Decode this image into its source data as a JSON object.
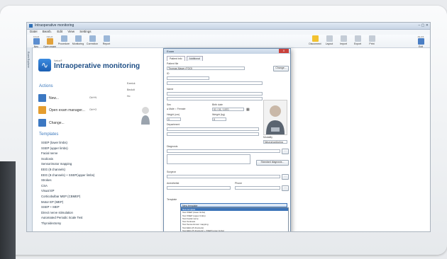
{
  "window": {
    "title": "Intraoperative monitoring"
  },
  "menu": [
    "Datei",
    "Bearb.",
    "Edit",
    "View",
    "Settings"
  ],
  "toolbar": [
    {
      "label": "Neu",
      "key": "Ctrl+N",
      "color": "#5c8ed0"
    },
    {
      "label": "Open exam",
      "key": "Ctrl+O",
      "color": "#e2a23c"
    },
    {
      "label": "Procedure",
      "key": "",
      "color": "#9bb7d8"
    },
    {
      "label": "Monitoring",
      "key": "",
      "color": "#9bb7d8"
    },
    {
      "label": "Correction",
      "key": "",
      "color": "#9bb7d8"
    },
    {
      "label": "Report",
      "key": "",
      "color": "#9bb7d8"
    },
    {
      "label": "Disconnect",
      "key": "",
      "color": "#f2c230"
    },
    {
      "label": "Layout",
      "key": "",
      "color": "#c4ccd6"
    },
    {
      "label": "Import",
      "key": "",
      "color": "#c4ccd6"
    },
    {
      "label": "Export",
      "key": "",
      "color": "#c4ccd6"
    },
    {
      "label": "Print",
      "key": "",
      "color": "#c4ccd6"
    },
    {
      "label": "Exit",
      "key": "Alt+F4",
      "color": "#4a7ec4"
    }
  ],
  "sidebar_tab": "Exam Explorer",
  "header": {
    "brand": "Natus®",
    "title": "Intraoperative monitoring"
  },
  "actions": {
    "title": "Actions",
    "items": [
      {
        "label": "New...",
        "key": "Ctrl+N",
        "color": "#3c78c2"
      },
      {
        "label": "Open exam manager...",
        "key": "Ctrl+O",
        "color": "#e59d2e"
      },
      {
        "label": "Change...",
        "key": "",
        "color": "#3c78c2"
      }
    ]
  },
  "mid_column": [
    "Ezerick",
    "Beckdt",
    "Ho"
  ],
  "templates": {
    "title": "Templates",
    "items": [
      "SSEP (lower limbs)",
      "SSEP (upper limbs)",
      "Facial nerve",
      "Scoliosis",
      "Sensorimotor mapping",
      "EEG (8 channels)",
      "EEG (8 channels) + SSEP(upper limbs)",
      "Strokes",
      "CSA",
      "Visual EP",
      "Corticobulbar MEP (CBMEP)",
      "Motor EP (MEP)",
      "SSEP + MEP",
      "Direct nerve stimulation",
      "Automated Periodic Scale Test",
      "Thyroidectomy"
    ]
  },
  "dialog": {
    "title": "Exam",
    "close": "X",
    "tabs": [
      "Patient info",
      "Additional"
    ],
    "patient_file_label": "Patient file",
    "patient_file_value": "Thomas Mayer (FOO)",
    "change_label": "Change...",
    "id_label": "ID",
    "name_label": "Name",
    "sex_label": "Sex",
    "sex_options": "● Male  ○ Female",
    "birth_label": "Birth date",
    "birth_value": "01 / 01 / 1970",
    "height_label": "Height (cm)",
    "height_value": "0",
    "weight_label": "Weight (kg)",
    "weight_value": "0",
    "modality_label": "Modality",
    "modality_value": "Neuromonitoring",
    "department_label": "Department",
    "diagnosis_label": "Diagnosis",
    "standard_diagnosis_label": "Standard diagnosis...",
    "surgeon_label": "Surgeon",
    "anesthetist_label": "Anesthetist",
    "phone_label": "Phone",
    "template_label": "Template",
    "template_selected": "New template",
    "template_options": [
      "New template",
      "Test SSEP (lower limbs)",
      "Test SSEP (upper limbs)",
      "Test Facial nerve",
      "Test Scoliosis",
      "Test Sensorimotor mapping",
      "Test EEG (8 channels)",
      "Test EEG (8 channels) + SSEP(upper limbs)",
      "Test Strokes",
      "Test CSA",
      "Test Visual EP",
      "Test Corticobulbar EP (CBEP)",
      "Test Motor EP (MEP)",
      "Test SSEP + MEP",
      "Test Direct nerve stimulation"
    ]
  }
}
